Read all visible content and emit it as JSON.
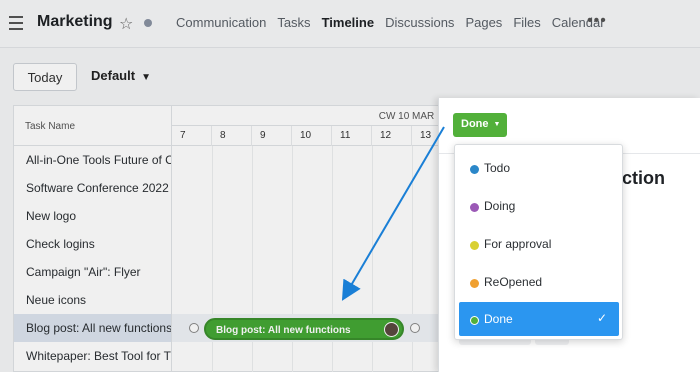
{
  "header": {
    "title": "Marketing",
    "tabs": [
      {
        "label": "Communication",
        "active": false
      },
      {
        "label": "Tasks",
        "active": false
      },
      {
        "label": "Timeline",
        "active": true
      },
      {
        "label": "Discussions",
        "active": false
      },
      {
        "label": "Pages",
        "active": false
      },
      {
        "label": "Files",
        "active": false
      },
      {
        "label": "Calendar",
        "active": false
      }
    ],
    "more": "•••"
  },
  "toolbar": {
    "today_label": "Today",
    "view_label": "Default"
  },
  "gantt": {
    "task_name_header": "Task Name",
    "week_label": "CW 10 MAR",
    "days": [
      "7",
      "8",
      "9",
      "10",
      "11",
      "12",
      "13"
    ],
    "tasks": [
      "All-in-One Tools Future of C",
      "Software Conference 2022",
      "New logo",
      "Check logins",
      "Campaign \"Air\": Flyer",
      "Neue icons",
      "Blog post: All new functions",
      "Whitepaper: Best Tool for T"
    ],
    "bar_label": "Blog post: All new functions"
  },
  "panel": {
    "title_fragment": "function",
    "status_label": "Done",
    "statuses": [
      {
        "label": "Todo",
        "color": "#2b87c9"
      },
      {
        "label": "Doing",
        "color": "#9b59b6"
      },
      {
        "label": "For approval",
        "color": "#d9d032"
      },
      {
        "label": "ReOpened",
        "color": "#f0a030"
      },
      {
        "label": "Done",
        "color": "#52b03a",
        "selected": true
      }
    ]
  },
  "colors": {
    "accent": "#2b96f0",
    "done_green": "#52b03a",
    "arrow": "#1a7fd6"
  }
}
